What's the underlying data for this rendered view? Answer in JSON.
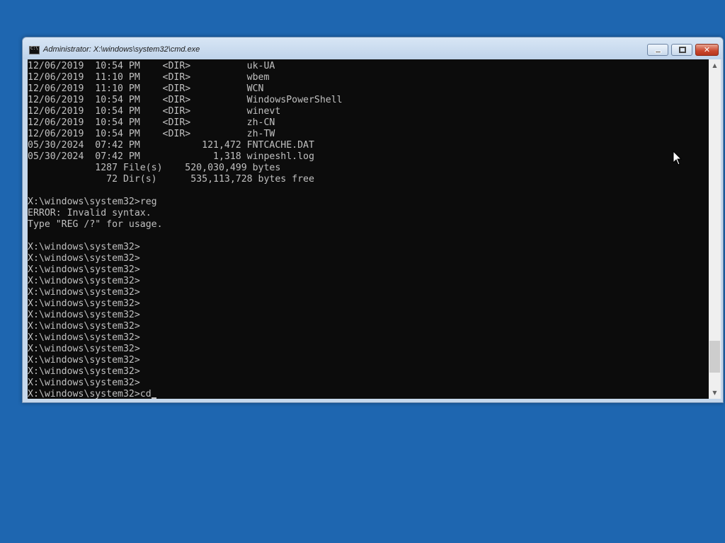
{
  "window": {
    "title": "Administrator: X:\\windows\\system32\\cmd.exe",
    "minimize_label": "minimize",
    "maximize_label": "maximize",
    "close_label": "close"
  },
  "console": {
    "lines": [
      "12/06/2019  10:54 PM    <DIR>          uk-UA",
      "12/06/2019  11:10 PM    <DIR>          wbem",
      "12/06/2019  11:10 PM    <DIR>          WCN",
      "12/06/2019  10:54 PM    <DIR>          WindowsPowerShell",
      "12/06/2019  10:54 PM    <DIR>          winevt",
      "12/06/2019  10:54 PM    <DIR>          zh-CN",
      "12/06/2019  10:54 PM    <DIR>          zh-TW",
      "05/30/2024  07:42 PM           121,472 FNTCACHE.DAT",
      "05/30/2024  07:42 PM             1,318 winpeshl.log",
      "            1287 File(s)    520,030,499 bytes",
      "              72 Dir(s)      535,113,728 bytes free",
      "",
      "X:\\windows\\system32>reg",
      "ERROR: Invalid syntax.",
      "Type \"REG /?\" for usage.",
      "",
      "X:\\windows\\system32>",
      "X:\\windows\\system32>",
      "X:\\windows\\system32>",
      "X:\\windows\\system32>",
      "X:\\windows\\system32>",
      "X:\\windows\\system32>",
      "X:\\windows\\system32>",
      "X:\\windows\\system32>",
      "X:\\windows\\system32>",
      "X:\\windows\\system32>",
      "X:\\windows\\system32>",
      "X:\\windows\\system32>",
      "X:\\windows\\system32>"
    ],
    "current_input": "X:\\windows\\system32>cd"
  },
  "scrollbar": {
    "up_glyph": "▲",
    "down_glyph": "▼",
    "position_fraction": 0.95
  },
  "colors": {
    "desktop": "#1e66b0",
    "console_bg": "#0c0c0c",
    "console_text": "#c0c0c0",
    "close_button": "#c9462c"
  },
  "icons": {
    "app": "cmd-icon",
    "pointer": "mouse-pointer-icon"
  }
}
